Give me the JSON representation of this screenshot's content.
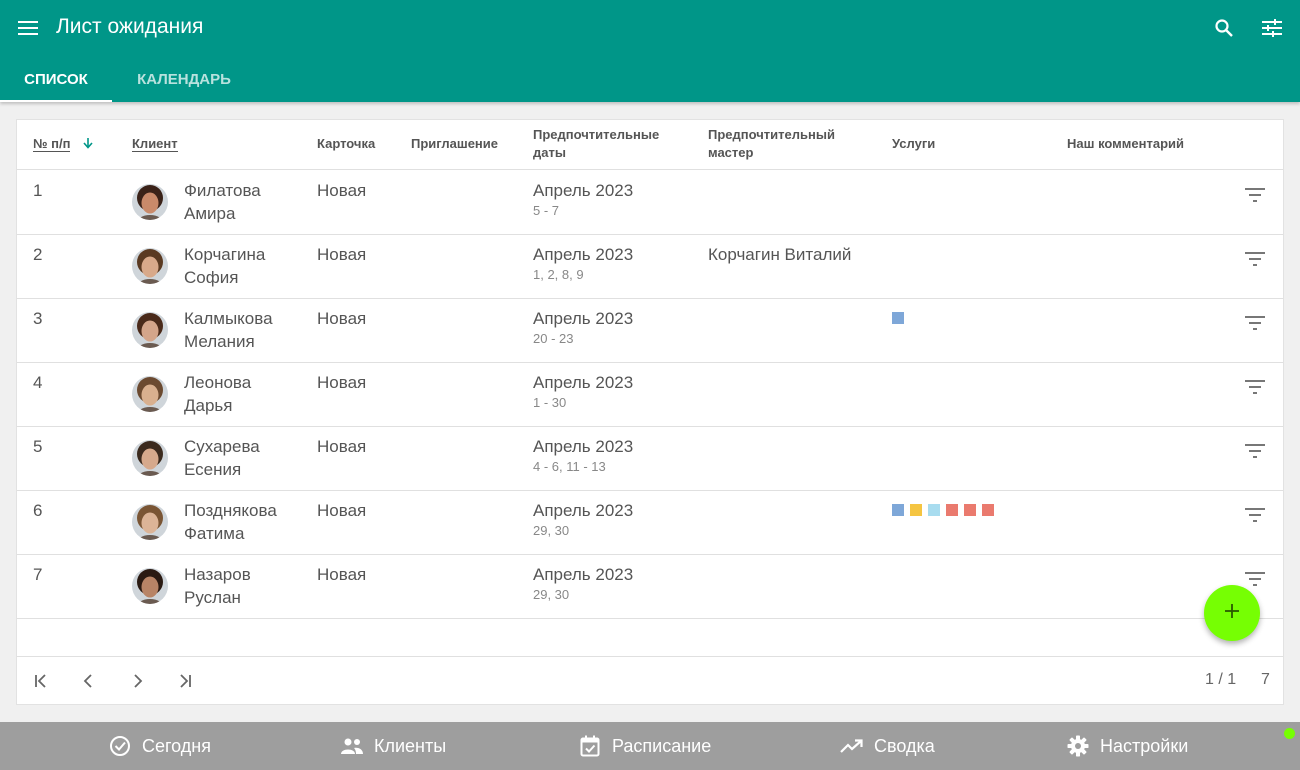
{
  "appbar": {
    "title": "Лист ожидания",
    "menu_icon": "menu-icon",
    "search_icon": "search-icon",
    "tune_icon": "tune-icon"
  },
  "tabs": [
    {
      "label": "СПИСОК",
      "active": true
    },
    {
      "label": "КАЛЕНДАРЬ",
      "active": false
    }
  ],
  "table": {
    "columns": {
      "num": "№ п/п",
      "client": "Клиент",
      "card": "Карточка",
      "invite": "Приглашение",
      "dates_line1": "Предпочтительные",
      "dates_line2": "даты",
      "master_line1": "Предпочтительный",
      "master_line2": "мастер",
      "services": "Услуги",
      "comment": "Наш комментарий"
    },
    "sort_icon": "arrow-down-icon",
    "rows": [
      {
        "num": "1",
        "last": "Филатова",
        "first": "Амира",
        "card": "Новая",
        "month": "Апрель 2023",
        "days": "5 - 7",
        "master": "",
        "services": []
      },
      {
        "num": "2",
        "last": "Корчагина",
        "first": "София",
        "card": "Новая",
        "month": "Апрель 2023",
        "days": "1, 2, 8, 9",
        "master": "Корчагин Виталий",
        "services": []
      },
      {
        "num": "3",
        "last": "Калмыкова",
        "first": "Мелания",
        "card": "Новая",
        "month": "Апрель 2023",
        "days": "20 - 23",
        "master": "",
        "services": [
          "#7ea7d8"
        ]
      },
      {
        "num": "4",
        "last": "Леонова",
        "first": "Дарья",
        "card": "Новая",
        "month": "Апрель 2023",
        "days": "1 - 30",
        "master": "",
        "services": []
      },
      {
        "num": "5",
        "last": "Сухарева",
        "first": "Есения",
        "card": "Новая",
        "month": "Апрель 2023",
        "days": "4 - 6, 11 - 13",
        "master": "",
        "services": []
      },
      {
        "num": "6",
        "last": "Позднякова",
        "first": "Фатима",
        "card": "Новая",
        "month": "Апрель 2023",
        "days": "29, 30",
        "master": "",
        "services": [
          "#7ea7d8",
          "#f5c542",
          "#a8dcef",
          "#ea7a6e",
          "#ea7a6e",
          "#ea7a6e"
        ]
      },
      {
        "num": "7",
        "last": "Назаров",
        "first": "Руслан",
        "card": "Новая",
        "month": "Апрель 2023",
        "days": "29, 30",
        "master": "",
        "services": []
      }
    ]
  },
  "pager": {
    "page": "1 / 1",
    "total": "7"
  },
  "fab_icon": "plus-icon",
  "bottom_nav": [
    {
      "label": "Сегодня",
      "icon": "check-circle-icon"
    },
    {
      "label": "Клиенты",
      "icon": "people-icon"
    },
    {
      "label": "Расписание",
      "icon": "calendar-check-icon"
    },
    {
      "label": "Сводка",
      "icon": "trending-up-icon"
    },
    {
      "label": "Настройки",
      "icon": "gear-icon"
    }
  ],
  "colors": {
    "primary": "#009688",
    "fab": "#76ff03",
    "bottom_bar": "#9e9e9e",
    "status_dot": "#76ff03"
  }
}
